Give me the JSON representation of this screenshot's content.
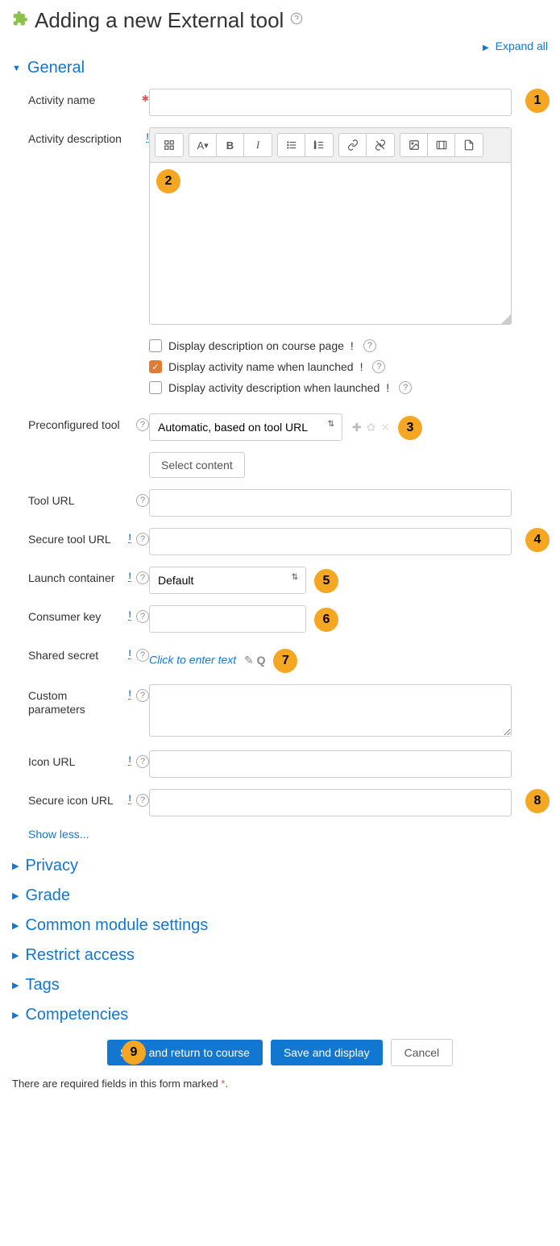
{
  "title": "Adding a new External tool",
  "expand_all": "Expand all",
  "sections": {
    "general": "General",
    "privacy": "Privacy",
    "grade": "Grade",
    "common": "Common module settings",
    "restrict": "Restrict access",
    "tags": "Tags",
    "competencies": "Competencies"
  },
  "labels": {
    "activity_name": "Activity name",
    "activity_description": "Activity description",
    "display_desc_course": "Display description on course page",
    "display_name_launch": "Display activity name when launched",
    "display_desc_launch": "Display activity description when launched",
    "preconfigured_tool": "Preconfigured tool",
    "select_content": "Select content",
    "tool_url": "Tool URL",
    "secure_tool_url": "Secure tool URL",
    "launch_container": "Launch container",
    "consumer_key": "Consumer key",
    "shared_secret": "Shared secret",
    "custom_parameters": "Custom parameters",
    "icon_url": "Icon URL",
    "secure_icon_url": "Secure icon URL",
    "show_less": "Show less..."
  },
  "values": {
    "preconfigured_tool": "Automatic, based on tool URL",
    "launch_container": "Default",
    "shared_secret_placeholder": "Click to enter text"
  },
  "buttons": {
    "save_return": "Save and return to course",
    "save_display": "Save and display",
    "cancel": "Cancel"
  },
  "footnote_text": "There are required fields in this form marked ",
  "footnote_mark": "*",
  "footnote_dot": ".",
  "callouts": {
    "c1": "1",
    "c2": "2",
    "c3": "3",
    "c4": "4",
    "c5": "5",
    "c6": "6",
    "c7": "7",
    "c8": "8",
    "c9": "9"
  }
}
